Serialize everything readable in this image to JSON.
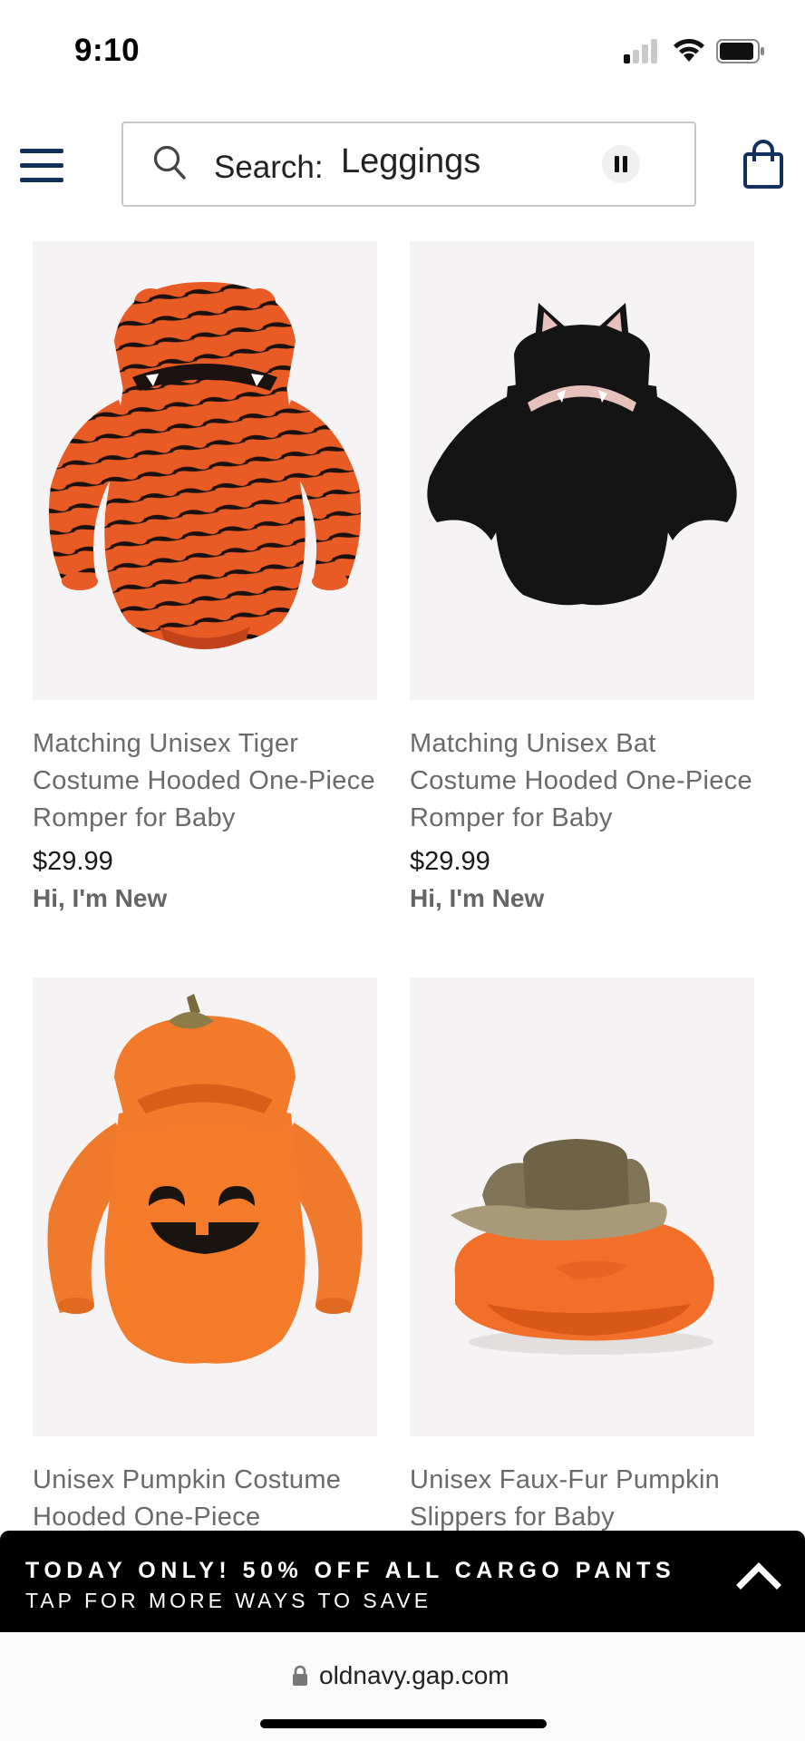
{
  "status_bar": {
    "time": "9:10"
  },
  "header": {
    "search_prefix": "Search:",
    "search_query": "Leggings"
  },
  "products": [
    {
      "title": "Matching Unisex Tiger Costume Hooded One-Piece Romper for Baby",
      "price": "$29.99",
      "badge": "Hi, I'm New"
    },
    {
      "title": "Matching Unisex Bat Costume Hooded One-Piece Romper for Baby",
      "price": "$29.99",
      "badge": "Hi, I'm New"
    },
    {
      "title": "Unisex Pumpkin Costume Hooded One-Piece",
      "price": "",
      "badge": ""
    },
    {
      "title": "Unisex Faux-Fur Pumpkin Slippers for Baby",
      "price": "",
      "badge": ""
    }
  ],
  "promo": {
    "title": "TODAY ONLY! 50% OFF ALL CARGO PANTS",
    "subtitle": "TAP FOR MORE WAYS TO SAVE"
  },
  "browser": {
    "url": "oldnavy.gap.com"
  },
  "colors": {
    "brand_navy": "#12305e",
    "promo_bg": "#000000",
    "image_bg": "#f5f3f3"
  }
}
